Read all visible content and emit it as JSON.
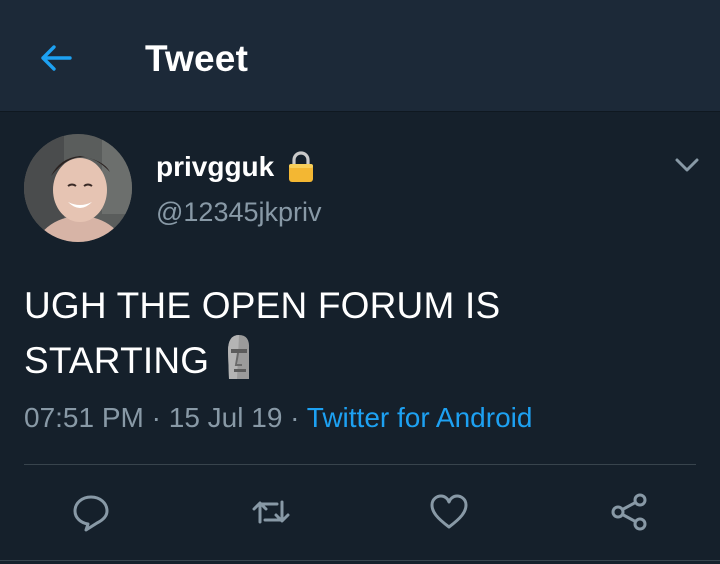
{
  "header": {
    "title": "Tweet",
    "back_icon": "arrow-left-icon"
  },
  "tweet": {
    "display_name": "privgguk",
    "handle": "@12345jkpriv",
    "text_line1": "UGH THE OPEN FORUM IS",
    "text_line2": "STARTING",
    "emoji": "moai",
    "time": "07:51 PM",
    "date": "15 Jul 19",
    "source": "Twitter for Android",
    "protected": true
  },
  "actions": [
    "reply-icon",
    "retweet-icon",
    "like-icon",
    "share-icon"
  ],
  "colors": {
    "background": "#15202b",
    "header": "#1c2938",
    "accent": "#1da1f2",
    "secondary_text": "#8899a6"
  }
}
